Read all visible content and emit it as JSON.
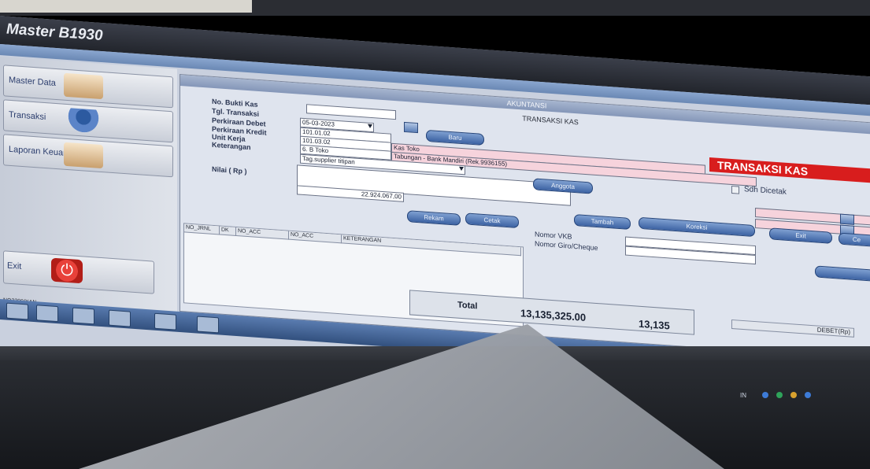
{
  "app": {
    "title": "Master B1930"
  },
  "sidebar": {
    "items": [
      {
        "label": "Master Data",
        "icon": "notepad-pen-icon"
      },
      {
        "label": "Transaksi",
        "icon": "person-computer-icon"
      },
      {
        "label": "Laporan Keuangan",
        "icon": "folder-report-icon"
      }
    ],
    "exit_label": "Exit",
    "status": "NO2209/XAN"
  },
  "panel": {
    "title": "AKUNTANSI",
    "caption": "TRANSAKSI KAS",
    "banner": "TRANSAKSI KAS",
    "printed_label": "Sdh Dicetak",
    "labels": {
      "no_bukti": "No. Bukti Kas",
      "tgl": "Tgl. Transaksi",
      "debet": "Perkiraan Debet",
      "kredit": "Perkiraan Kredit",
      "unit": "Unit Kerja",
      "keterangan": "Keterangan",
      "nilai": "Nilai ( Rp )"
    },
    "fields": {
      "no_bukti_value": "",
      "tgl_value": "05-03-2023",
      "debet_code": "101.01.02",
      "kredit_code": "101.03.02",
      "unit_code": "6. B Toko",
      "debet_name": "Kas Toko",
      "kredit_name": "Tabungan - Bank Mandiri (Rek.9936155)",
      "keterangan_value": "Tag.supplier titipan",
      "nilai_value": "22.924.067,00"
    },
    "buttons": {
      "baru": "Baru",
      "rekam": "Rekam",
      "cetak": "Cetak",
      "anggota": "Anggota",
      "tambah": "Tambah",
      "koreksi": "Koreksi",
      "exit": "Exit",
      "partial": "Ce"
    },
    "vkb": {
      "nomor_vkb": "Nomor VKB",
      "nomor_giro": "Nomor Giro/Cheque"
    },
    "grid": {
      "headers": [
        "NO_JRNL",
        "DK",
        "NO_ACC",
        "NO_ACC",
        "KETERANGAN"
      ],
      "debet_header": "DEBET(Rp)"
    },
    "total": {
      "label": "Total",
      "value": "13,135,325.00",
      "value_partial": "13,135"
    }
  },
  "taskbar": {
    "tray_text": "IN"
  },
  "colors": {
    "banner": "#d81d1d",
    "accent": "#3d63a3",
    "pink_field": "#f6d3dc"
  }
}
